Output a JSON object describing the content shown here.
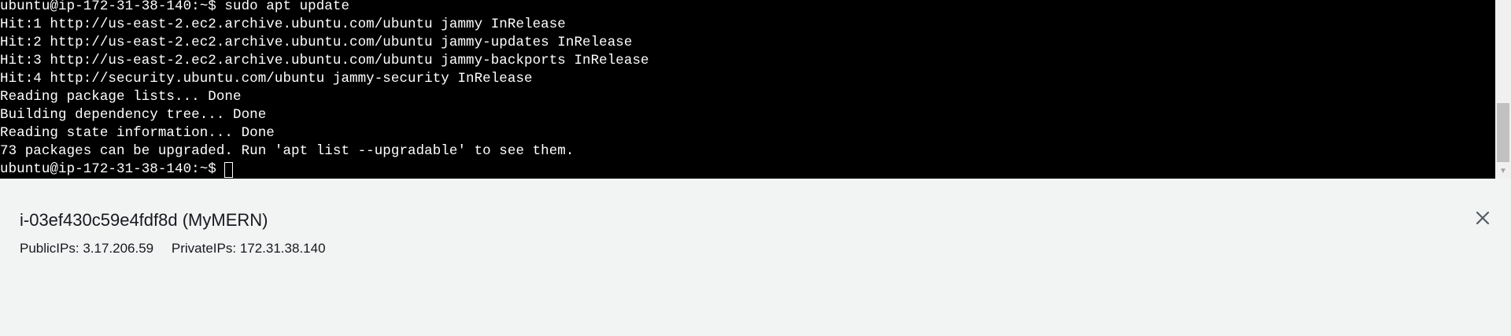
{
  "terminal": {
    "lines": [
      "ubuntu@ip-172-31-38-140:~$ sudo apt update",
      "Hit:1 http://us-east-2.ec2.archive.ubuntu.com/ubuntu jammy InRelease",
      "Hit:2 http://us-east-2.ec2.archive.ubuntu.com/ubuntu jammy-updates InRelease",
      "Hit:3 http://us-east-2.ec2.archive.ubuntu.com/ubuntu jammy-backports InRelease",
      "Hit:4 http://security.ubuntu.com/ubuntu jammy-security InRelease",
      "Reading package lists... Done",
      "Building dependency tree... Done",
      "Reading state information... Done",
      "73 packages can be upgraded. Run 'apt list --upgradable' to see them."
    ],
    "prompt": "ubuntu@ip-172-31-38-140:~$ "
  },
  "instance": {
    "title": "i-03ef430c59e4fdf8d (MyMERN)",
    "public_ips_label": "PublicIPs:",
    "public_ips_value": "3.17.206.59",
    "private_ips_label": "PrivateIPs:",
    "private_ips_value": "172.31.38.140"
  },
  "icons": {
    "close": "close-icon",
    "scroll_down": "scroll-down-arrow-icon"
  },
  "colors": {
    "terminal_background": "#000000",
    "terminal_text": "#ffffff",
    "panel_background": "#f2f3f3",
    "panel_text": "#16191f"
  }
}
